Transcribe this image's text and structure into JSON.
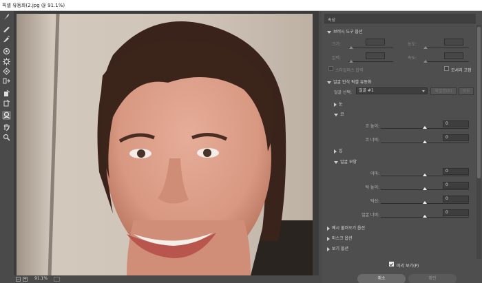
{
  "window": {
    "title": "픽셀 유동화(2.jpg @ 91.1%)"
  },
  "toolbar": {
    "tools": [
      "forward-warp-tool",
      "reconstruct-tool",
      "smooth-tool",
      "twirl-clockwise-tool",
      "pucker-tool",
      "bloat-tool",
      "push-left-tool",
      "freeze-mask-tool",
      "thaw-mask-tool",
      "face-tool",
      "hand-tool",
      "zoom-tool"
    ],
    "active": "face-tool"
  },
  "status": {
    "zoom": "91.1%",
    "minus": "−",
    "plus": "+"
  },
  "panel": {
    "title": "속성",
    "brush": {
      "header": "브러시 도구 옵션",
      "size_label": "크기:",
      "density_label": "농도:",
      "pressure_label": "압력:",
      "rate_label": "속도:",
      "stylus_label": "스타일러스 압력",
      "pin_edges_label": "모서리 고정"
    },
    "face": {
      "header": "얼굴 인식 픽셀 유동화",
      "select_label": "얼굴 선택:",
      "select_value": "얼굴 #1",
      "reset_label": "재설정(R)",
      "all_label": "모두",
      "eyes": "눈",
      "nose": "코",
      "nose_height_label": "코 높이:",
      "nose_height": "0",
      "nose_width_label": "코 너비:",
      "nose_width": "0",
      "mouth": "입",
      "face_shape": "얼굴 모양",
      "forehead_label": "이마:",
      "forehead": "0",
      "chin_height_label": "턱 높이:",
      "chin_height": "0",
      "jawline_label": "턱선:",
      "jawline": "0",
      "face_width_label": "얼굴 너비:",
      "face_width": "0"
    },
    "load_mesh": "메시 불러오기 옵션",
    "mask": "마스크 옵션",
    "view": "보기 옵션",
    "preview_label": "미리 보기(P)",
    "cancel": "취소",
    "ok": "확인"
  },
  "colors": {
    "panel_bg": "#4e4e4e",
    "toolbar_bg": "#4a4a4a",
    "accent": "#eeeeee"
  }
}
